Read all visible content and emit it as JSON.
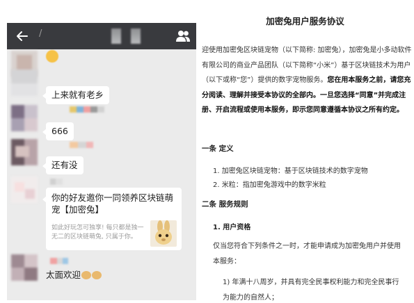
{
  "chat": {
    "title_char": "/",
    "messages": [
      {
        "type": "emoji",
        "text": ""
      },
      {
        "type": "text",
        "text": "上来就有老乡"
      },
      {
        "type": "text",
        "text": "666"
      },
      {
        "type": "text",
        "text": "还有没"
      },
      {
        "type": "card",
        "title": "你的好友邀你一同领养区块链萌宠【加密兔】",
        "description": "如此好玩怎可独享! 每只都是独一无二的区块链萌兔, 只属于你。"
      },
      {
        "type": "text",
        "text": "太面欢迎"
      }
    ]
  },
  "doc": {
    "title": "加密兔用户服务协议",
    "intro_normal": "迎使用加密兔区块链宠物（以下简称: 加密兔），加密兔是小多动软件有限公司的商业产品团队（以下简称“小米”）基于区块链技术为用户（以下或称“您”）提供的数字宠物服务。",
    "intro_bold": "您在用本服务之前，请您充分阅读、理解并接受本协议的全部内。一旦您选择“同意”并完成注册、开启流程或使用本服务，即示您同意遵循本协议之所有约定。",
    "section1_title": "一条 定义",
    "section1_items": [
      "1. 加密兔区块链宠物：基于区块链技术的数字宠物",
      "2. 米粒：指加密兔游戏中的数字米粒"
    ],
    "section2_title": "二条 服务规则",
    "section2_sub": "1. 用户资格",
    "section2_para": "仅当您符合下列条件之一时，才能申请成为加密兔用户并使用本服务：",
    "section2_item": "1) 年满十八周岁，并具有完全民事权利能力和完全民事行为能力的自然人；"
  }
}
